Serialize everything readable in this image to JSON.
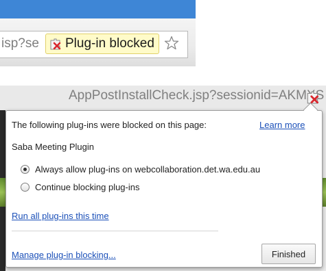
{
  "address_bar": {
    "url_fragment": "isp?se",
    "blocked_chip_label": "Plug-in blocked",
    "icons": {
      "blocked": "plugin-blocked-icon",
      "star": "bookmark-star-icon"
    }
  },
  "bubble_url_line": "AppPostInstallCheck.jsp?sessionid=AKMXS",
  "bubble": {
    "title": "The following plug-ins were blocked on this page:",
    "learn_more": "Learn more",
    "plugin_name": "Saba Meeting Plugin",
    "options": [
      {
        "label": "Always allow plug-ins on webcollaboration.det.wa.edu.au",
        "selected": true
      },
      {
        "label": "Continue blocking plug-ins",
        "selected": false
      }
    ],
    "run_all_link": "Run all plug-ins this time",
    "manage_link": "Manage plug-in blocking...",
    "finished_button": "Finished"
  },
  "colors": {
    "link": "#1a4fb8",
    "chip_background": "#fffbc9",
    "blocked_x": "#d9272e",
    "top_strip": "#3e86d6"
  }
}
